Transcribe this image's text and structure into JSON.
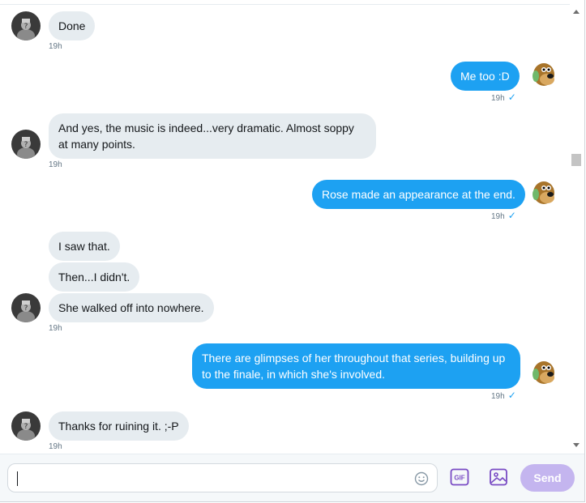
{
  "messages": [
    {
      "side": "in",
      "avatar": "user-avatar-hat",
      "lines": [
        "Done"
      ],
      "time": "19h"
    },
    {
      "side": "out",
      "avatar": "user-avatar-dog",
      "lines": [
        "Me too :D"
      ],
      "time": "19h"
    },
    {
      "side": "in",
      "avatar": "user-avatar-hat",
      "lines": [
        "And yes, the music is indeed...very dramatic. Almost soppy at many points."
      ],
      "time": "19h"
    },
    {
      "side": "out",
      "avatar": "user-avatar-dog",
      "lines": [
        "Rose made an appearance at the end."
      ],
      "time": "19h"
    },
    {
      "side": "in",
      "avatar": "user-avatar-hat",
      "lines": [
        "I saw that.",
        "Then...I didn't.",
        "She walked off into nowhere."
      ],
      "time": "19h"
    },
    {
      "side": "out",
      "avatar": "user-avatar-dog",
      "lines": [
        "There are glimpses of her throughout that series, building up to the finale, in which she's involved."
      ],
      "time": "19h"
    },
    {
      "side": "in",
      "avatar": "user-avatar-hat",
      "lines": [
        "Thanks for ruining it. ;-P"
      ],
      "time": "19h"
    }
  ],
  "composer": {
    "placeholder": "",
    "value": "",
    "emoji_icon": "smiley-icon",
    "gif_label": "GIF",
    "image_icon": "image-icon",
    "send_label": "Send"
  },
  "colors": {
    "outgoing": "#1da1f2",
    "incoming": "#e6ecf0",
    "send_disabled": "#c4b5ef",
    "accent_purple": "#794bc4"
  }
}
